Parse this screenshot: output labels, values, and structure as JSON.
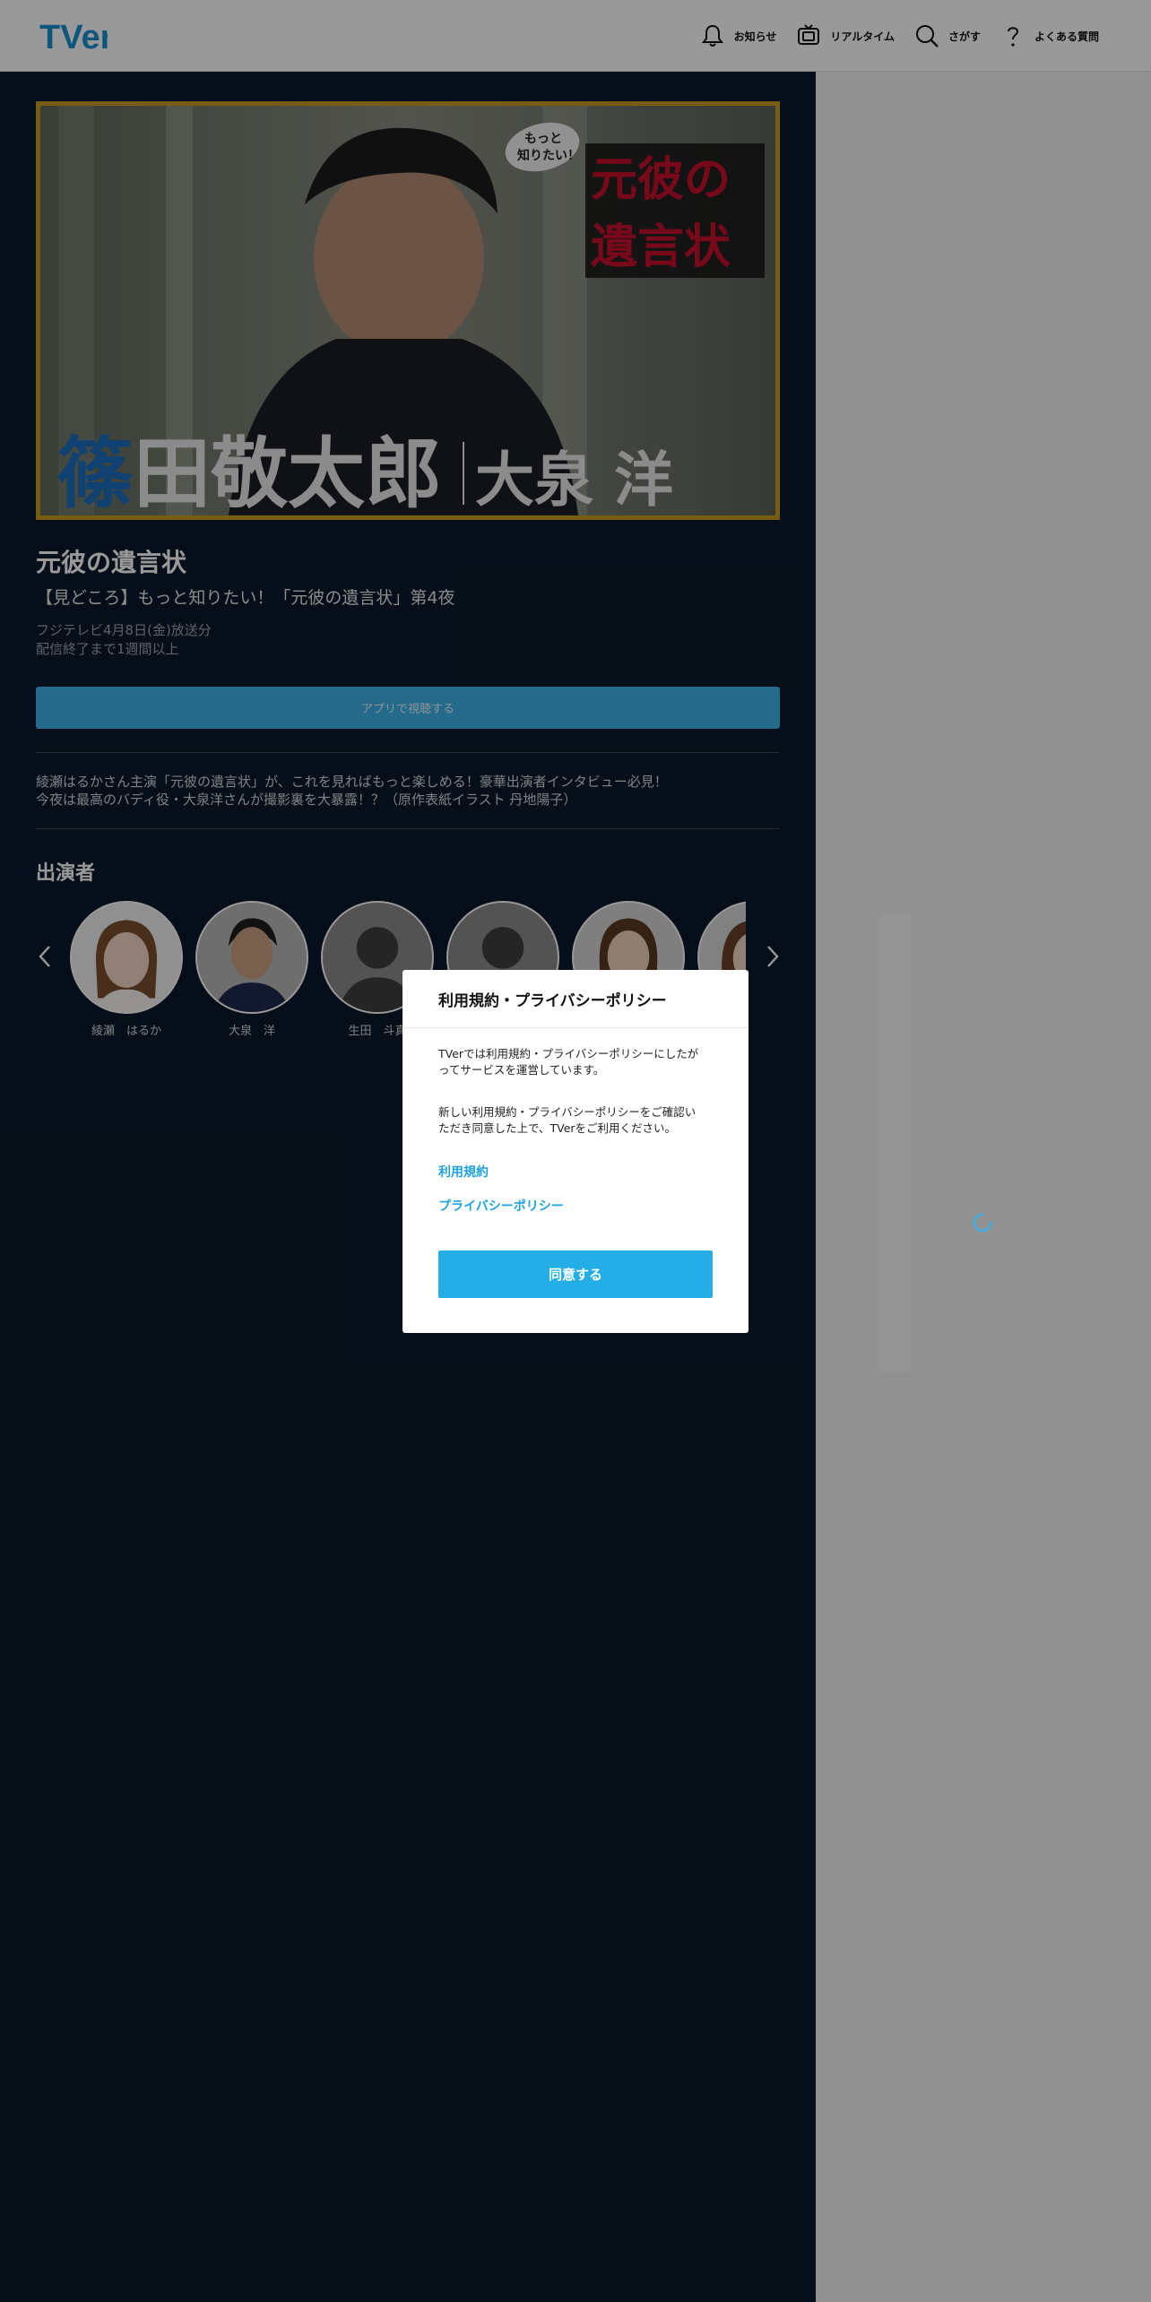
{
  "header": {
    "logo_text": "TVer",
    "nav": [
      {
        "label": "お知らせ",
        "icon": "bell-icon"
      },
      {
        "label": "リアルタイム",
        "icon": "tv-icon"
      },
      {
        "label": "さがす",
        "icon": "search-icon"
      },
      {
        "label": "よくある質問",
        "icon": "question-icon"
      }
    ]
  },
  "episode": {
    "title": "元彼の遺言状",
    "subtitle": "【見どころ】もっと知りたい！「元彼の遺言状」第4夜",
    "broadcast": "フジテレビ4月8日(金)放送分",
    "availability": "配信終了まで1週間以上",
    "app_button": "アプリで視聴する",
    "description_line1": "綾瀬はるかさん主演「元彼の遺言状」が、これを見ればもっと楽しめる！豪華出演者インタビュー必見！",
    "description_line2": "今夜は最高のバディ役・大泉洋さんが撮影裏を大暴露！？（原作表紙イラスト 丹地陽子）"
  },
  "thumbnail": {
    "bubble_line1": "もっと",
    "bubble_line2": "知りたい！",
    "show_title_line1": "元彼の",
    "show_title_line2": "遺言状",
    "role_first_char": "篠",
    "role_rest": "田敬太郎",
    "actor": "大泉 洋"
  },
  "cast": {
    "heading": "出演者",
    "members": [
      {
        "name": "綾瀬　はるか"
      },
      {
        "name": "大泉　洋"
      },
      {
        "name": "生田　斗真"
      },
      {
        "name": ""
      },
      {
        "name": ""
      },
      {
        "name": ""
      }
    ]
  },
  "modal": {
    "title": "利用規約・プライバシーポリシー",
    "para1_line1": "TVerでは利用規約・プライバシーポリシーにしたが",
    "para1_line2": "ってサービスを運営しています。",
    "para2_line1": "新しい利用規約・プライバシーポリシーをご確認い",
    "para2_line2": "ただき同意した上で、TVerをご利用ください。",
    "link_terms": "利用規約",
    "link_privacy": "プライバシーポリシー",
    "agree_button": "同意する"
  },
  "colors": {
    "accent": "#25aee5",
    "main_bg": "#0a1a2a",
    "thumbnail_border": "#c99a1c",
    "title_red": "#c8102e"
  }
}
